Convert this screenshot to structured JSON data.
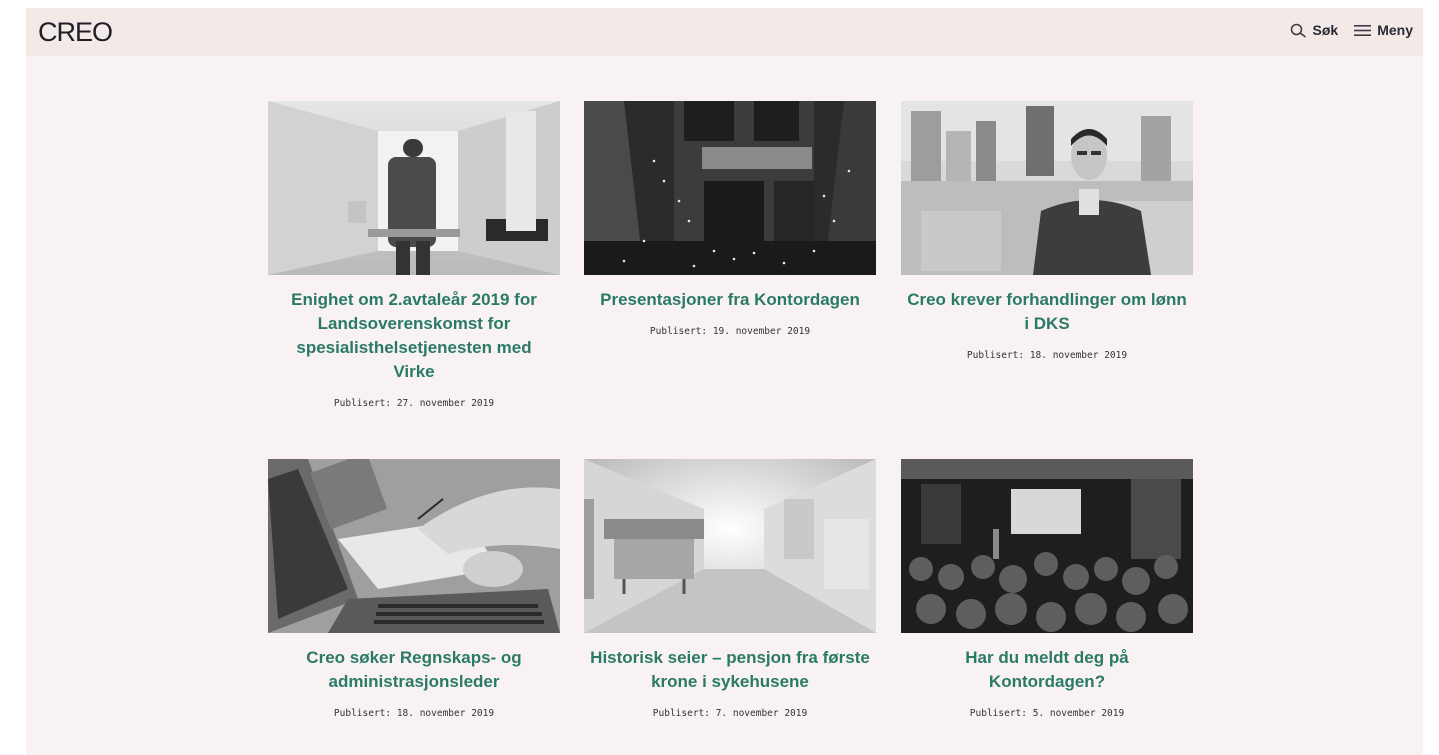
{
  "header": {
    "logo": "CREO",
    "search_label": "Søk",
    "menu_label": "Meny"
  },
  "articles": [
    {
      "title": "Enighet om 2.avtaleår 2019 for Landsoverenskomst for spesialisthelsetjenesten med Virke",
      "date": "Publisert: 27. november 2019",
      "image": "hospital-corridor-nurse-photo"
    },
    {
      "title": "Presentasjoner fra Kontordagen",
      "date": "Publisert: 19. november 2019",
      "image": "building-aerial-night-photo"
    },
    {
      "title": "Creo krever forhandlinger om lønn i DKS",
      "date": "Publisert: 18. november 2019",
      "image": "man-portrait-city-photo"
    },
    {
      "title": "Creo søker Regnskaps- og administrasjonsleder",
      "date": "Publisert: 18. november 2019",
      "image": "laptop-desk-paperwork-photo"
    },
    {
      "title": "Historisk seier – pensjon fra første krone i sykehusene",
      "date": "Publisert: 7. november 2019",
      "image": "hospital-hallway-bed-photo"
    },
    {
      "title": "Har du meldt deg på Kontordagen?",
      "date": "Publisert: 5. november 2019",
      "image": "conference-audience-photo"
    }
  ],
  "colors": {
    "accent": "#2b7a67",
    "background": "#f8f3f2",
    "header": "#f3e9e7"
  }
}
